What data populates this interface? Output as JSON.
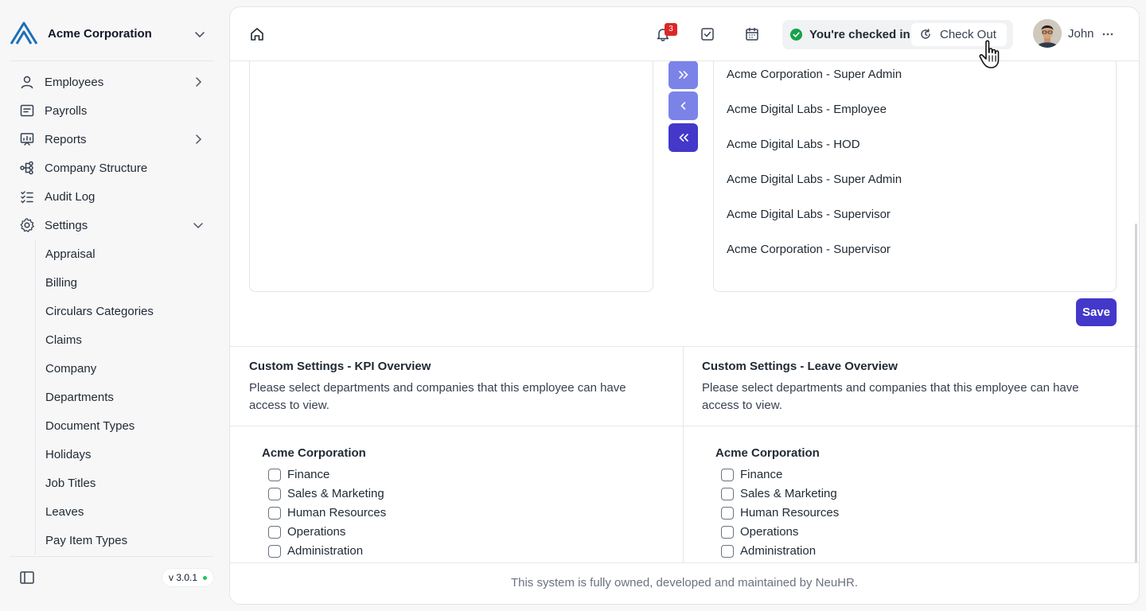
{
  "sidebar": {
    "org_name": "Acme Corporation",
    "nav": [
      {
        "label": "Employees",
        "icon": "user-icon",
        "has_chevron": true
      },
      {
        "label": "Payrolls",
        "icon": "payroll-icon",
        "has_chevron": false
      },
      {
        "label": "Reports",
        "icon": "reports-icon",
        "has_chevron": true
      },
      {
        "label": "Company Structure",
        "icon": "structure-icon",
        "has_chevron": false
      },
      {
        "label": "Audit Log",
        "icon": "audit-log-icon",
        "has_chevron": false
      },
      {
        "label": "Settings",
        "icon": "gear-icon",
        "has_chevron": true,
        "expanded": true
      }
    ],
    "settings_items": [
      "Appraisal",
      "Billing",
      "Circulars Categories",
      "Claims",
      "Company",
      "Departments",
      "Document Types",
      "Holidays",
      "Job Titles",
      "Leaves",
      "Pay Item Types"
    ],
    "version": "v 3.0.1"
  },
  "topbar": {
    "notification_count": "3",
    "checkin_status": "You're checked in",
    "checkout_label": "Check Out",
    "user_name": "John"
  },
  "roles": {
    "assigned": [
      "Acme Corporation - Super Admin",
      "Acme Digital Labs - Employee",
      "Acme Digital Labs - HOD",
      "Acme Digital Labs - Super Admin",
      "Acme Digital Labs - Supervisor",
      "Acme Corporation - Supervisor"
    ],
    "save_label": "Save"
  },
  "custom_settings": [
    {
      "title": "Custom Settings - KPI Overview",
      "description": "Please select departments and companies that this employee can have access to view.",
      "company": "Acme Corporation",
      "departments": [
        "Finance",
        "Sales & Marketing",
        "Human Resources",
        "Operations",
        "Administration"
      ]
    },
    {
      "title": "Custom Settings - Leave Overview",
      "description": "Please select departments and companies that this employee can have access to view.",
      "company": "Acme Corporation",
      "departments": [
        "Finance",
        "Sales & Marketing",
        "Human Resources",
        "Operations",
        "Administration"
      ]
    }
  ],
  "footer": "This system is fully owned, developed and maintained by NeuHR.",
  "colors": {
    "primary": "#4338ca",
    "primary_light": "#7c83e8",
    "success": "#16a34a",
    "badge": "#dc2626"
  }
}
